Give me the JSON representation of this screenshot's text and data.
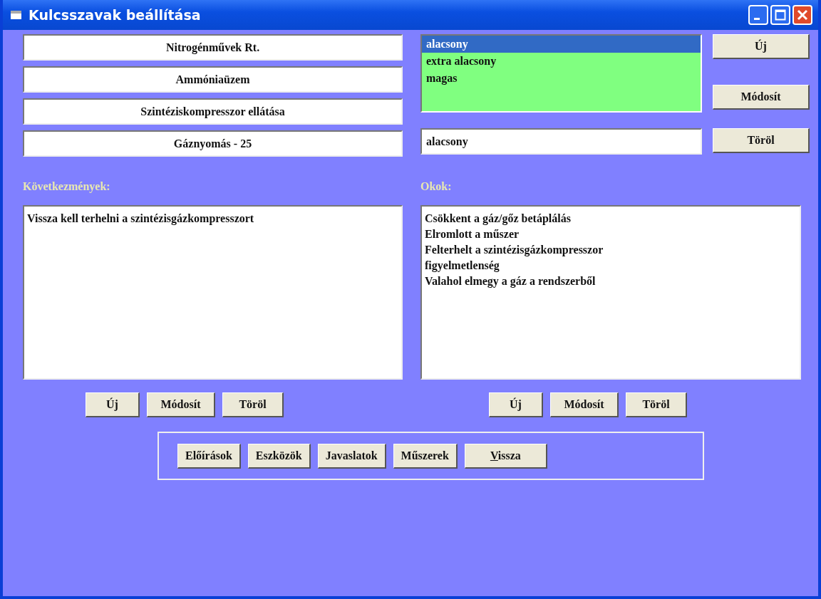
{
  "window": {
    "title": "Kulcsszavak beállítása"
  },
  "header_fields": [
    "Nitrogénművek Rt.",
    "Ammóniaüzem",
    "Szintéziskompresszor ellátása",
    "Gáznyomás - 25"
  ],
  "level_list": {
    "items": [
      {
        "label": "alacsony",
        "selected": true
      },
      {
        "label": "extra alacsony",
        "selected": false
      },
      {
        "label": "magas",
        "selected": false
      }
    ],
    "buttons": [
      "Új",
      "Módosít"
    ]
  },
  "level_input": {
    "value": "alacsony"
  },
  "level_delete_button": "Töröl",
  "consequences": {
    "label": "Következmények:",
    "items": [
      "Vissza kell terhelni a szintézisgázkompresszort"
    ],
    "buttons": [
      "Új",
      "Módosít",
      "Töröl"
    ]
  },
  "causes": {
    "label": "Okok:",
    "items": [
      "Csökkent a gáz/gőz betáplálás",
      "Elromlott a műszer",
      "Felterhelt a szintézisgázkompresszor",
      "figyelmetlenség",
      "Valahol elmegy a gáz a rendszerből"
    ],
    "buttons": [
      "Új",
      "Módosít",
      "Töröl"
    ]
  },
  "bottom_buttons": [
    {
      "label": "Előírások"
    },
    {
      "label": "Eszközök"
    },
    {
      "label": "Javaslatok"
    },
    {
      "label": "Műszerek"
    },
    {
      "access_key": "V",
      "label_rest": "issza"
    }
  ]
}
